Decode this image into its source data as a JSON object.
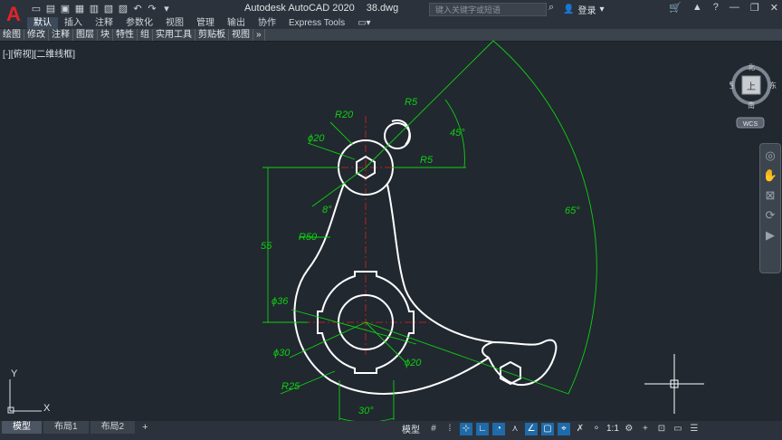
{
  "titlebar": {
    "app_name": "Autodesk AutoCAD 2020",
    "file_name": "38.dwg",
    "search_placeholder": "键入关键字或短语",
    "login_label": "登录",
    "app_logo": "A"
  },
  "ribbon": {
    "tabs": [
      "默认",
      "插入",
      "注释",
      "参数化",
      "视图",
      "管理",
      "输出",
      "协作",
      "Express Tools"
    ],
    "active_tab": "默认",
    "panels": [
      "绘图",
      "修改",
      "注释",
      "图层",
      "块",
      "特性",
      "组",
      "实用工具",
      "剪贴板",
      "视图"
    ]
  },
  "viewport": {
    "label": "[-][俯视][二维线框]"
  },
  "navcube": {
    "north": "北",
    "south": "南",
    "east": "东",
    "west": "西",
    "face": "上",
    "wcs": "WCS"
  },
  "ucs": {
    "x": "X",
    "y": "Y"
  },
  "dimensions": {
    "r20": "R20",
    "r5_top": "R5",
    "r5_mid": "R5",
    "phi20_top": "ϕ20",
    "angle45": "45°",
    "angle8": "8°",
    "len55": "55",
    "r50": "R50",
    "angle65": "65°",
    "phi36": "ϕ36",
    "phi30": "ϕ30",
    "phi20_bottom": "ϕ20",
    "r25": "R25",
    "angle30": "30°"
  },
  "layout_tabs": [
    "模型",
    "布局1",
    "布局2"
  ],
  "layout_add": "+",
  "statusbar": {
    "model_label": "模型",
    "scale": "1:1"
  },
  "colors": {
    "background": "#212830",
    "geometry": "#ffffff",
    "dimension": "#10d010",
    "centerline": "#e02020",
    "accent": "#1f6aa8"
  }
}
